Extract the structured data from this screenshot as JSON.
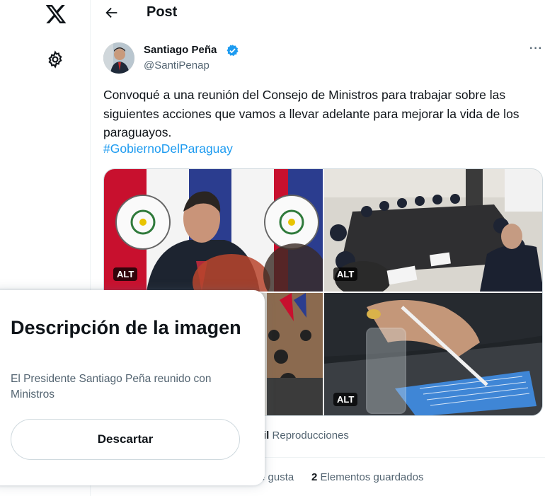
{
  "header": {
    "title": "Post"
  },
  "nav": {
    "logo_icon": "x-logo-icon",
    "settings_icon": "gear-icon"
  },
  "author": {
    "name": "Santiago Peña",
    "handle": "@SantiPenap",
    "verified_color": "#1d9bf0"
  },
  "tweet": {
    "text": "Convoqué a una reunión del Consejo de Ministros para trabajar sobre las siguientes acciones que vamos a llevar adelante para mejorar la vida de los paraguayos.",
    "hashtag": "#GobiernoDelParaguay",
    "more_label": "···"
  },
  "media": {
    "alt_label": "ALT",
    "images": [
      "photo-1",
      "photo-2",
      "photo-3",
      "photo-4"
    ]
  },
  "stats": {
    "views_number": "il",
    "views_label": "Reproducciones",
    "likes_label": "e gusta",
    "saved_count": "2",
    "saved_label": "Elementos guardados"
  },
  "alt_popup": {
    "title": "Descripción de la imagen",
    "description": "El Presidente Santiago Peña reunido con Ministros",
    "dismiss_label": "Descartar"
  },
  "colors": {
    "accent": "#1d9bf0",
    "muted": "#536471",
    "text": "#0f1419"
  }
}
